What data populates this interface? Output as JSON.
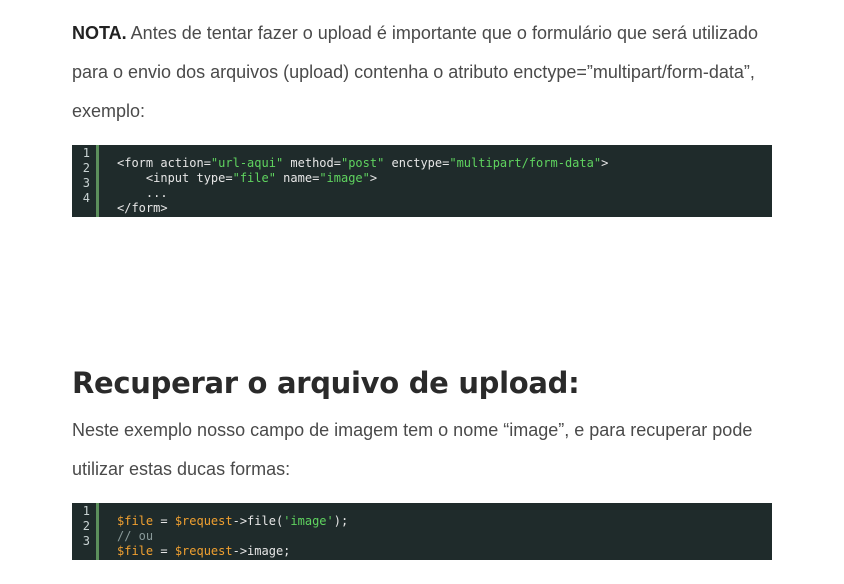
{
  "note": {
    "label": "NOTA.",
    "text": " Antes de tentar fazer o upload é importante que o formulário que será utilizado para o envio dos arquivos (upload) contenha o atributo enctype=”multipart/form-data”, exemplo:"
  },
  "code1": {
    "line_numbers": [
      "1",
      "2",
      "3",
      "4"
    ],
    "lines": [
      [
        {
          "t": "tag",
          "v": "<form action="
        },
        {
          "t": "str",
          "v": "\"url-aqui\""
        },
        {
          "t": "tag",
          "v": " method="
        },
        {
          "t": "str",
          "v": "\"post\""
        },
        {
          "t": "tag",
          "v": " enctype="
        },
        {
          "t": "str",
          "v": "\"multipart/form-data\""
        },
        {
          "t": "tag",
          "v": ">"
        }
      ],
      [
        {
          "t": "tag",
          "v": "    <input type="
        },
        {
          "t": "str",
          "v": "\"file\""
        },
        {
          "t": "tag",
          "v": " name="
        },
        {
          "t": "str",
          "v": "\"image\""
        },
        {
          "t": "tag",
          "v": ">"
        }
      ],
      [
        {
          "t": "tag",
          "v": "    ..."
        }
      ],
      [
        {
          "t": "tag",
          "v": "</form>"
        }
      ]
    ]
  },
  "section": {
    "heading": "Recuperar o arquivo de upload:",
    "text": "Neste exemplo nosso campo de imagem tem o nome “image”, e para recuperar pode utilizar estas ducas formas:"
  },
  "code2": {
    "line_numbers": [
      "1",
      "2",
      "3"
    ],
    "lines": [
      [
        {
          "t": "var",
          "v": "$file"
        },
        {
          "t": "op",
          "v": " = "
        },
        {
          "t": "var",
          "v": "$request"
        },
        {
          "t": "op",
          "v": "->file("
        },
        {
          "t": "str",
          "v": "'image'"
        },
        {
          "t": "op",
          "v": ");"
        }
      ],
      [
        {
          "t": "cmt",
          "v": "// ou"
        }
      ],
      [
        {
          "t": "var",
          "v": "$file"
        },
        {
          "t": "op",
          "v": " = "
        },
        {
          "t": "var",
          "v": "$request"
        },
        {
          "t": "op",
          "v": "->image;"
        }
      ]
    ]
  }
}
